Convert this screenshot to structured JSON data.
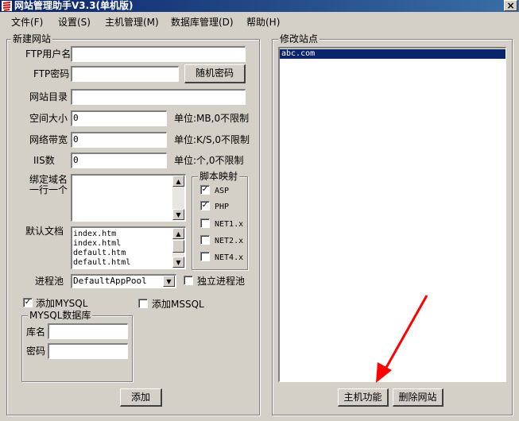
{
  "window": {
    "title": "网站管理助手V3.3(单机版)",
    "close_glyph": "×"
  },
  "menu": [
    {
      "label": "文件(F)"
    },
    {
      "label": "设置(S)"
    },
    {
      "label": "主机管理(M)"
    },
    {
      "label": "数据库管理(D)"
    },
    {
      "label": "帮助(H)"
    }
  ],
  "new_site": {
    "group_title": "新建网站",
    "ftp_user_label": "FTP用户名",
    "ftp_user_value": "",
    "ftp_pass_label": "FTP密码",
    "ftp_pass_value": "",
    "random_pass_button": "随机密码",
    "site_dir_label": "网站目录",
    "site_dir_value": "",
    "space_label": "空间大小",
    "space_value": "0",
    "space_unit": "单位:MB,0不限制",
    "bandwidth_label": "网络带宽",
    "bandwidth_value": "0",
    "bandwidth_unit": "单位:K/S,0不限制",
    "iis_label": "IIS数",
    "iis_value": "0",
    "iis_unit": "单位:个,0不限制",
    "domain_label_1": "绑定域名",
    "domain_label_2": "一行一个",
    "domain_value": "",
    "default_doc_label": "默认文档",
    "default_docs": [
      "index.htm",
      "index.html",
      "default.htm",
      "default.html"
    ],
    "script_group_title": "脚本映射",
    "scripts": [
      {
        "label": "ASP",
        "checked": true
      },
      {
        "label": "PHP",
        "checked": true
      },
      {
        "label": "NET1.x",
        "checked": false
      },
      {
        "label": "NET2.x",
        "checked": false
      },
      {
        "label": "NET4.x",
        "checked": false
      }
    ],
    "pool_label": "进程池",
    "pool_value": "DefaultAppPool",
    "independent_pool_label": "独立进程池",
    "add_mysql_label": "添加MYSQL",
    "add_mssql_label": "添加MSSQL",
    "mysql_group_title": "MYSQL数据库",
    "db_name_label": "库名",
    "db_name_value": "",
    "db_pass_label": "密码",
    "db_pass_value": "",
    "add_button": "添加",
    "check_glyph": "✓"
  },
  "modify_site": {
    "group_title": "修改站点",
    "sites": [
      "abc.com"
    ],
    "host_function_button": "主机功能",
    "delete_site_button": "删除网站"
  },
  "colors": {
    "title_start": "#0a246a",
    "title_end": "#3a6ea5",
    "arrow": "#ff0000",
    "selection": "#0a246a"
  }
}
